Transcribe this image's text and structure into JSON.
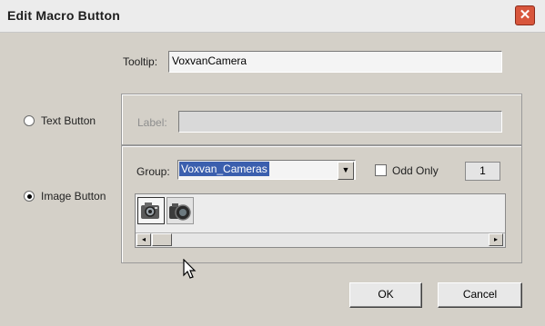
{
  "dialog": {
    "title": "Edit Macro Button",
    "close_glyph": "✕"
  },
  "tooltip": {
    "label": "Tooltip:",
    "value": "VoxvanCamera"
  },
  "text_button": {
    "label": "Text Button",
    "selected": false
  },
  "label_field": {
    "label": "Label:",
    "value": ""
  },
  "image_button": {
    "label": "Image Button",
    "selected": true
  },
  "group": {
    "label": "Group:",
    "selected": "Voxvan_Cameras",
    "arrow_glyph": "▼"
  },
  "odd_only": {
    "label": "Odd Only",
    "checked": false,
    "count": "1"
  },
  "icons": [
    {
      "name": "camera-icon",
      "selected": true
    },
    {
      "name": "camera-lens-icon",
      "selected": false
    }
  ],
  "scrollbar": {
    "left_glyph": "◂",
    "right_glyph": "▸"
  },
  "buttons": {
    "ok": "OK",
    "cancel": "Cancel"
  }
}
